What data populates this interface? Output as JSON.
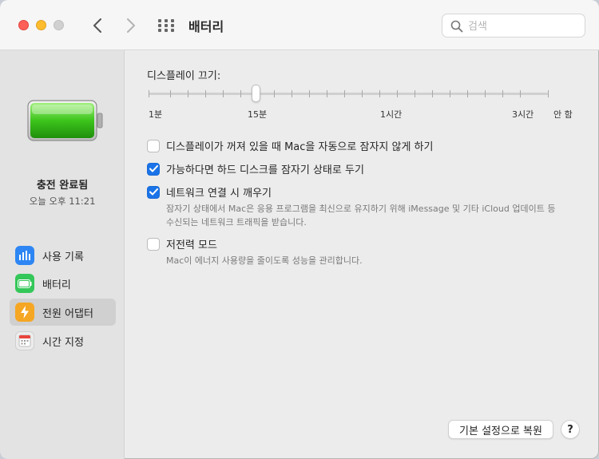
{
  "window": {
    "title": "배터리"
  },
  "search": {
    "placeholder": "검색"
  },
  "sidebar": {
    "status_title": "충전 완료됨",
    "status_time": "오늘 오후 11:21",
    "items": [
      {
        "label": "사용 기록",
        "icon": "chart-icon",
        "color": "#2d86f3"
      },
      {
        "label": "배터리",
        "icon": "battery-icon",
        "color": "#34c759"
      },
      {
        "label": "전원 어댑터",
        "icon": "bolt-icon",
        "color": "#f5a623"
      },
      {
        "label": "시간 지정",
        "icon": "calendar-icon",
        "color": "#e0e0e0"
      }
    ],
    "active_index": 2
  },
  "display_off": {
    "label": "디스플레이 끄기:",
    "tick_labels": [
      "1분",
      "15분",
      "1시간",
      "3시간",
      "안 함"
    ],
    "selected": "15분"
  },
  "options": [
    {
      "label": "디스플레이가 꺼져 있을 때 Mac을 자동으로 잠자지 않게 하기",
      "checked": false
    },
    {
      "label": "가능하다면 하드 디스크를 잠자기 상태로 두기",
      "checked": true
    },
    {
      "label": "네트워크 연결 시 깨우기",
      "checked": true,
      "description_line1": "잠자기 상태에서 Mac은 응용 프로그램을 최신으로 유지하기 위해 iMessage 및 기타 iCloud 업데이트 등",
      "description_line2": "수신되는 네트워크 트래픽을 받습니다."
    },
    {
      "label": "저전력 모드",
      "checked": false,
      "description_line1": "Mac이 에너지 사용량을 줄이도록 성능을 관리합니다."
    }
  ],
  "buttons": {
    "restore": "기본 설정으로 복원",
    "help": "?"
  }
}
